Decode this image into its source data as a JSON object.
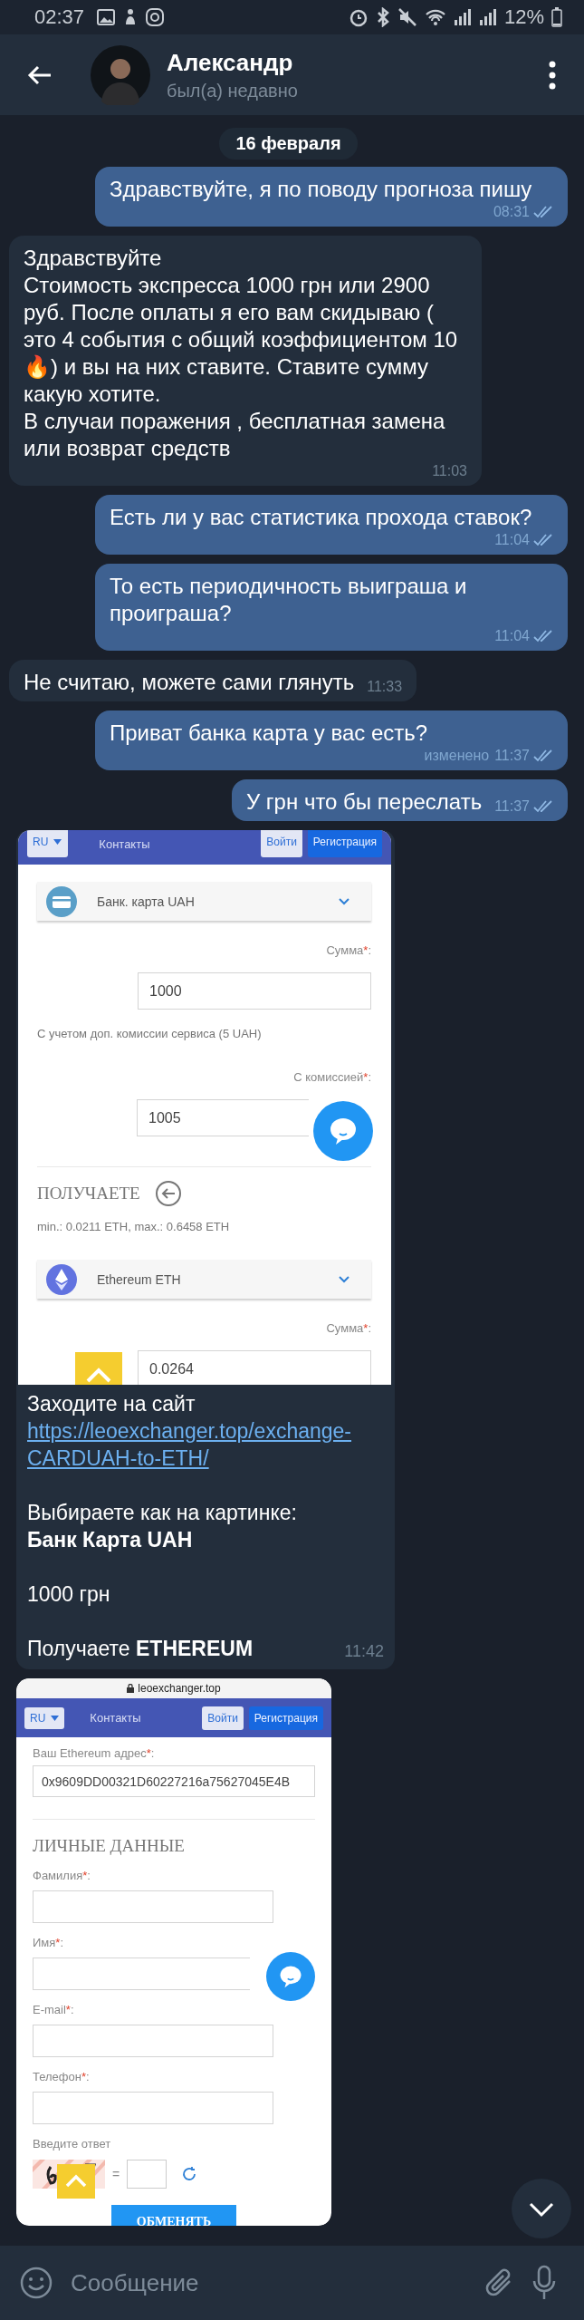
{
  "status_bar": {
    "time": "02:37",
    "battery": "12%"
  },
  "chat_header": {
    "name": "Александр",
    "status": "был(а) недавно"
  },
  "date_badge": "16 февраля",
  "messages": [
    {
      "kind": "text",
      "outgoing": true,
      "text": "Здравствуйте, я по поводу прогноза пишу",
      "time": "08:31",
      "read": true
    },
    {
      "kind": "text",
      "outgoing": false,
      "text": "Здравствуйте\nСтоимость экспресса 1000 грн или 2900 руб. После оплаты я его вам скидываю ( это 4 события с общий коэффициентом 10🔥) и вы на них ставите. Ставите сумму какую хотите.\nВ случаи поражения , бесплатная замена или возврат средств",
      "time": "11:03"
    },
    {
      "kind": "text",
      "outgoing": true,
      "text": "Есть ли у вас статистика прохода ставок?",
      "time": "11:04",
      "read": true
    },
    {
      "kind": "text",
      "outgoing": true,
      "text": "То есть периодичность выиграша и проиграша?",
      "time": "11:04",
      "read": true
    },
    {
      "kind": "text",
      "outgoing": false,
      "text": "Не считаю, можете сами глянуть",
      "time": "11:33"
    },
    {
      "kind": "text",
      "outgoing": true,
      "text": "Приват банка карта у вас есть?",
      "edited_label": "изменено",
      "time": "11:37",
      "read": true
    },
    {
      "kind": "text",
      "outgoing": true,
      "text": "У грн что бы переслать",
      "time": "11:37",
      "read": true
    },
    {
      "kind": "screenshot",
      "outgoing": false,
      "time": "11:42",
      "screenshot": {
        "nav": {
          "language": "RU",
          "contacts": "Контакты",
          "login": "Войти",
          "register": "Регистрация"
        },
        "items": [
          {
            "kind": "select",
            "value": "Банк. карта UAH"
          },
          {
            "kind": "label",
            "text": "Сумма",
            "mark": "*",
            "suffix": ":"
          },
          {
            "kind": "field",
            "value": "1000"
          },
          {
            "kind": "note",
            "text": "С учетом доп. комиссии сервиса (5 UAH)"
          },
          {
            "kind": "label",
            "text": "С комиссией",
            "mark": "*",
            "suffix": ":"
          },
          {
            "kind": "field",
            "value": "1005",
            "chat_widget": true
          },
          {
            "kind": "divider"
          },
          {
            "kind": "heading",
            "text": "ПОЛУЧАЕТЕ",
            "back_icon": true
          },
          {
            "kind": "note",
            "text": "min.: 0.0211 ETH, max.: 0.6458 ETH"
          },
          {
            "kind": "select",
            "value": "Ethereum ETH"
          },
          {
            "kind": "label",
            "text": "Сумма",
            "mark": "*",
            "suffix": ":"
          },
          {
            "kind": "field",
            "value": "0.0264",
            "scroll_top_button": true
          }
        ]
      },
      "caption": {
        "intro": "Заходите на сайт",
        "link": "https://leoexchanger.top/exchange-CARDUAH-to-ETH/",
        "paragraphs": [
          "Выбираете как на картинке:\n**Банк Карта UAH**",
          "1000 грн",
          "Получаете **ETHEREUM**"
        ]
      }
    },
    {
      "kind": "screenshot",
      "outgoing": false,
      "screenshot": {
        "url": "leoexchanger.top",
        "nav": {
          "language": "RU",
          "contacts": "Контакты",
          "login": "Войти",
          "register": "Регистрация"
        },
        "items": [
          {
            "kind": "label",
            "text": "Ваш Ethereum адрес",
            "mark": "*",
            "suffix": ":"
          },
          {
            "kind": "wide_field",
            "value": "0x9609DD00321D60227216a75627045E4B"
          },
          {
            "kind": "divider"
          },
          {
            "kind": "heading",
            "text": "ЛИЧНЫЕ ДАННЫЕ"
          },
          {
            "kind": "label",
            "text": "Фамилия",
            "mark": "*",
            "suffix": ":"
          },
          {
            "kind": "field",
            "value": ""
          },
          {
            "kind": "label",
            "text": "Имя",
            "mark": "*",
            "suffix": ":"
          },
          {
            "kind": "field",
            "value": "",
            "chat_widget": true
          },
          {
            "kind": "label",
            "text": "E-mail",
            "mark": "*",
            "suffix": ":"
          },
          {
            "kind": "field",
            "value": ""
          },
          {
            "kind": "label",
            "text": "Телефон",
            "mark": "*",
            "suffix": ":"
          },
          {
            "kind": "field",
            "value": ""
          },
          {
            "kind": "label",
            "text": "Введите ответ"
          },
          {
            "kind": "captcha",
            "equals": "=",
            "scroll_top_button": true
          },
          {
            "kind": "submit",
            "text": "ОБМЕНЯТЬ"
          }
        ]
      }
    }
  ],
  "composer": {
    "placeholder": "Сообщение"
  }
}
